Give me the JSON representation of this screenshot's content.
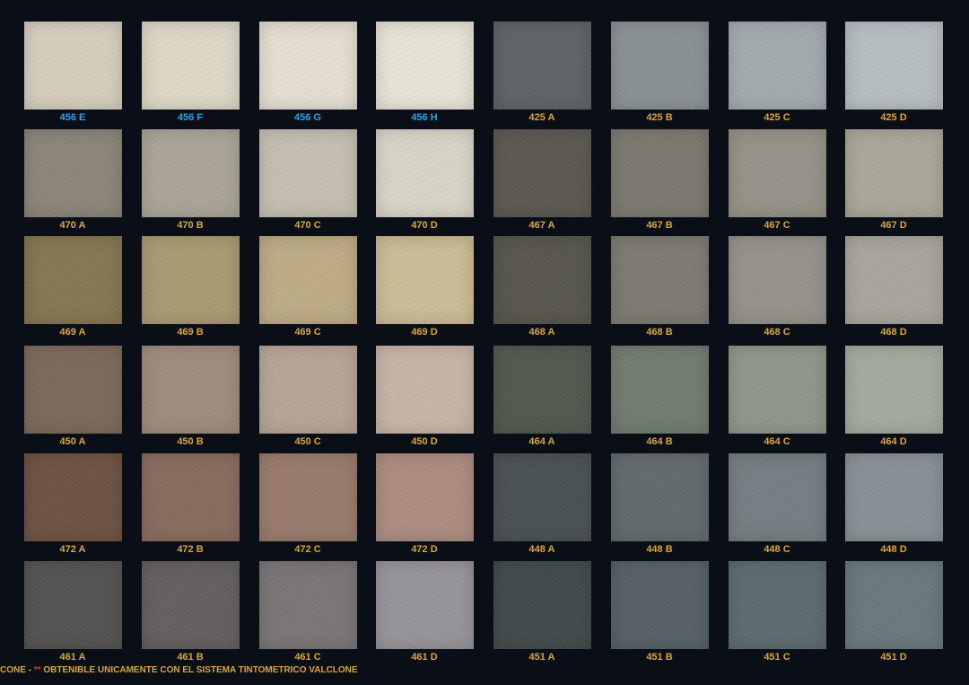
{
  "colors": {
    "label_blue": "#2aa3e6",
    "label_gold": "#d9a63c",
    "footer_gold": "#d9a63c",
    "footer_red": "#d8342a"
  },
  "swatches": [
    [
      {
        "code": "456 E",
        "color": "#d4cdbd",
        "label_color": "blue"
      },
      {
        "code": "456 F",
        "color": "#dcd6c6",
        "label_color": "blue"
      },
      {
        "code": "456 G",
        "color": "#e3ddd0",
        "label_color": "blue"
      },
      {
        "code": "456 H",
        "color": "#e7e2d6",
        "label_color": "blue"
      },
      {
        "code": "425 A",
        "color": "#5f6466",
        "label_color": "gold"
      },
      {
        "code": "425 B",
        "color": "#8a9194",
        "label_color": "gold"
      },
      {
        "code": "425 C",
        "color": "#a3aaae",
        "label_color": "gold"
      },
      {
        "code": "425 D",
        "color": "#b6bdc0",
        "label_color": "gold"
      }
    ],
    [
      {
        "code": "470 A",
        "color": "#8b857a",
        "label_color": "gold"
      },
      {
        "code": "470 B",
        "color": "#aaa497",
        "label_color": "gold"
      },
      {
        "code": "470 C",
        "color": "#c4beb1",
        "label_color": "gold"
      },
      {
        "code": "470 D",
        "color": "#d8d3c7",
        "label_color": "gold"
      },
      {
        "code": "467 A",
        "color": "#5c5a52",
        "label_color": "gold"
      },
      {
        "code": "467 B",
        "color": "#7c7a70",
        "label_color": "gold"
      },
      {
        "code": "467 C",
        "color": "#959287",
        "label_color": "gold"
      },
      {
        "code": "467 D",
        "color": "#aaa698",
        "label_color": "gold"
      }
    ],
    [
      {
        "code": "469 A",
        "color": "#867653",
        "label_color": "gold"
      },
      {
        "code": "469 B",
        "color": "#a99a73",
        "label_color": "gold"
      },
      {
        "code": "469 C",
        "color": "#bcab85",
        "label_color": "gold"
      },
      {
        "code": "469 D",
        "color": "#cbbb96",
        "label_color": "gold"
      },
      {
        "code": "468 A",
        "color": "#58574f",
        "label_color": "gold"
      },
      {
        "code": "468 B",
        "color": "#7d7b72",
        "label_color": "gold"
      },
      {
        "code": "468 C",
        "color": "#95928a",
        "label_color": "gold"
      },
      {
        "code": "468 D",
        "color": "#a8a59d",
        "label_color": "gold"
      }
    ],
    [
      {
        "code": "450 A",
        "color": "#7b6b5c",
        "label_color": "gold"
      },
      {
        "code": "450 B",
        "color": "#9e8d7e",
        "label_color": "gold"
      },
      {
        "code": "450 C",
        "color": "#b6a597",
        "label_color": "gold"
      },
      {
        "code": "450 D",
        "color": "#c6b4a6",
        "label_color": "gold"
      },
      {
        "code": "464 A",
        "color": "#525a50",
        "label_color": "gold"
      },
      {
        "code": "464 B",
        "color": "#737c71",
        "label_color": "gold"
      },
      {
        "code": "464 C",
        "color": "#8e9789",
        "label_color": "gold"
      },
      {
        "code": "464 D",
        "color": "#a3aa9d",
        "label_color": "gold"
      }
    ],
    [
      {
        "code": "472 A",
        "color": "#6e5444",
        "label_color": "gold"
      },
      {
        "code": "472 B",
        "color": "#8a6c5e",
        "label_color": "gold"
      },
      {
        "code": "472 C",
        "color": "#997b6d",
        "label_color": "gold"
      },
      {
        "code": "472 D",
        "color": "#ac8d80",
        "label_color": "gold"
      },
      {
        "code": "448 A",
        "color": "#4b5255",
        "label_color": "gold"
      },
      {
        "code": "448 B",
        "color": "#626b6e",
        "label_color": "gold"
      },
      {
        "code": "448 C",
        "color": "#757e82",
        "label_color": "gold"
      },
      {
        "code": "448 D",
        "color": "#889195",
        "label_color": "gold"
      }
    ],
    [
      {
        "code": "461 A",
        "color": "#555452",
        "label_color": "gold"
      },
      {
        "code": "461 B",
        "color": "#646062",
        "label_color": "gold"
      },
      {
        "code": "461 C",
        "color": "#7a7678",
        "label_color": "gold"
      },
      {
        "code": "461 D",
        "color": "#97949a",
        "label_color": "gold"
      },
      {
        "code": "451 A",
        "color": "#434b4c",
        "label_color": "gold"
      },
      {
        "code": "451 B",
        "color": "#566266",
        "label_color": "gold"
      },
      {
        "code": "451 C",
        "color": "#5d6c70",
        "label_color": "gold"
      },
      {
        "code": "451 D",
        "color": "#6a797e",
        "label_color": "gold"
      }
    ]
  ],
  "footer": {
    "prefix": "CONE - ",
    "marker": "**",
    "text": " OBTENIBLE UNICAMENTE CON EL SISTEMA TINTOMETRICO VALCLONE"
  }
}
